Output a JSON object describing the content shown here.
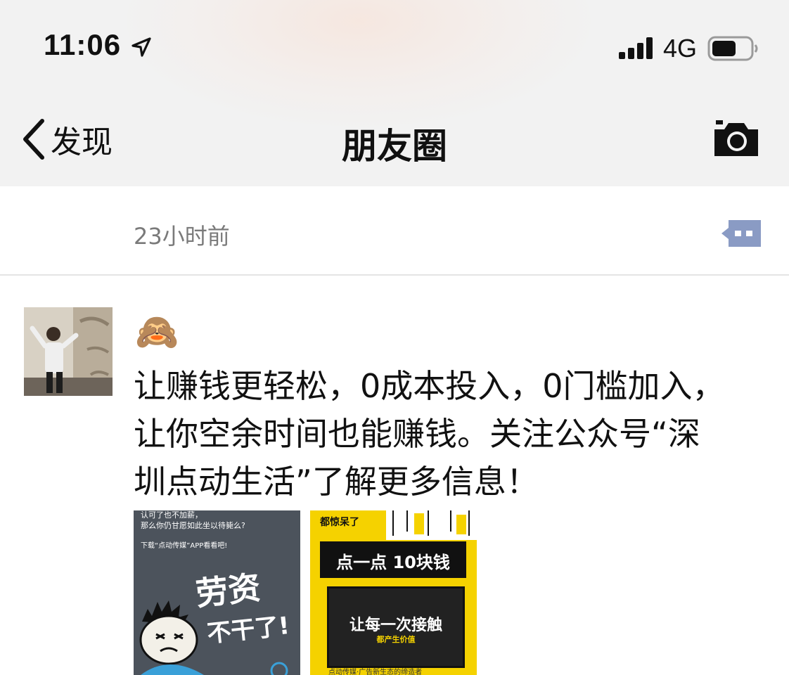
{
  "status_bar": {
    "time": "11:06",
    "network": "4G",
    "icons": [
      "location-arrow-icon",
      "signal-icon",
      "battery-icon"
    ]
  },
  "nav": {
    "back_label": "发现",
    "title": "朋友圈",
    "camera_icon": "camera-icon"
  },
  "post_header": {
    "time": "23小时前",
    "comment_icon": "comment-icon"
  },
  "post": {
    "emoji": "🙈",
    "text": "让赚钱更轻松，0成本投入，0门槛加入，\n让你空余时间也能赚钱。关注公众号“深\n圳点动生活”了解更多信息！",
    "images": [
      {
        "lines": [
          "认可了也不加薪，",
          "那么你仍甘愿如此坐以待毙么?",
          "下载“点动传媒”APP看看吧!"
        ],
        "headline": [
          "劳资",
          "不干了!"
        ]
      },
      {
        "top": "都惊呆了",
        "banner": "点一点 10块钱",
        "headline": "让每一次接触",
        "sub": "都产生价值",
        "bottom": "点动传媒·广告新生态的缔造者"
      }
    ]
  },
  "colors": {
    "header_bg": "#f2f2f2",
    "comment_icon": "#8a9bc4",
    "photo_dark": "#4c535c",
    "photo_yellow": "#f5d200"
  }
}
